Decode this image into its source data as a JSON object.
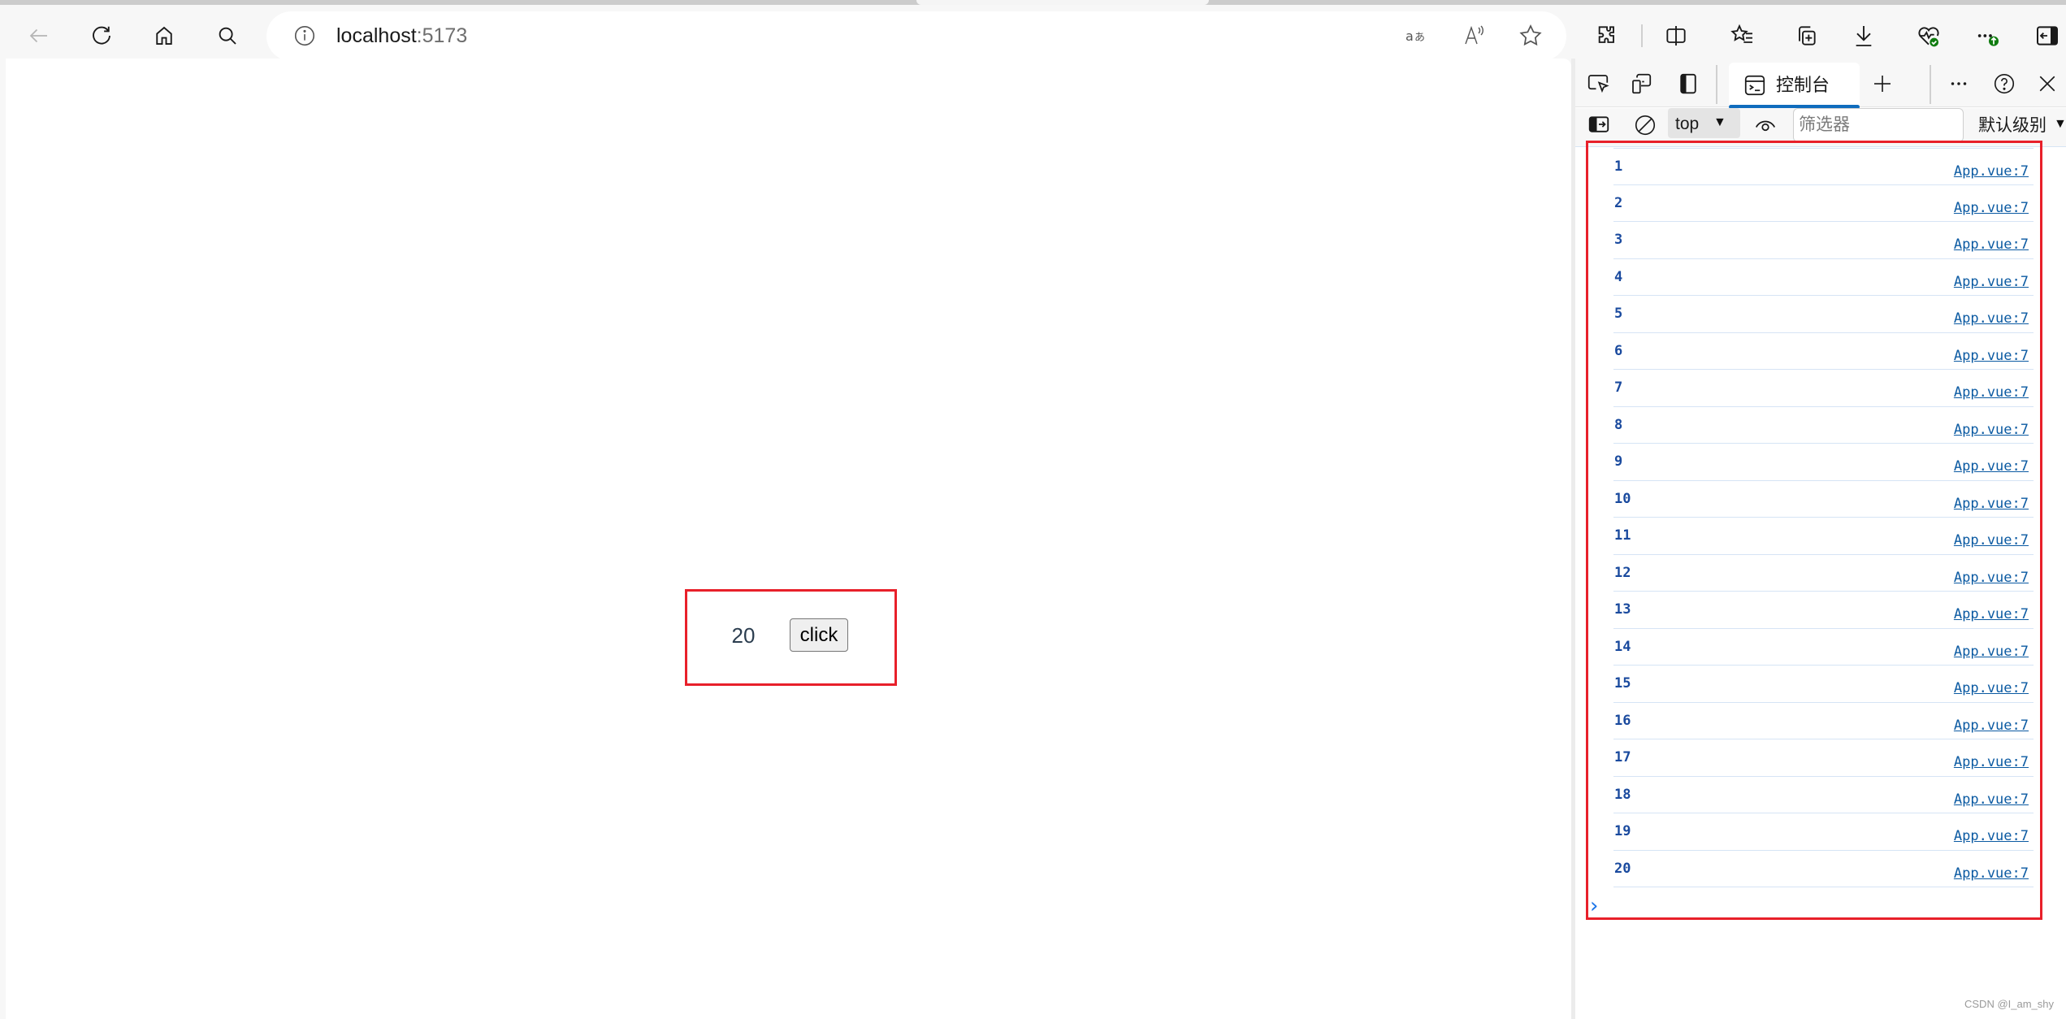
{
  "browser": {
    "url_host": "localhost",
    "url_port": ":5173",
    "nav": {
      "back": "back-arrow-icon",
      "refresh": "refresh-icon",
      "home": "home-icon",
      "search": "search-icon"
    },
    "address_icons": [
      "site-info-icon",
      "translate-icon",
      "read-aloud-icon",
      "favorite-star-icon"
    ],
    "toolbar_icons": [
      "extensions-icon",
      "split-screen-icon",
      "favorites-icon",
      "collections-icon",
      "downloads-icon",
      "browser-essentials-icon",
      "more-icon",
      "sidebar-toggle-icon"
    ]
  },
  "page": {
    "count": "20",
    "button_label": "click",
    "accent_color": "#e8202a"
  },
  "devtools": {
    "tab_label": "控制台",
    "context": "top",
    "filter_placeholder": "筛选器",
    "level_label": "默认级别",
    "prompt": "›",
    "console_rows": [
      {
        "value": "1",
        "source": "App.vue:7"
      },
      {
        "value": "2",
        "source": "App.vue:7"
      },
      {
        "value": "3",
        "source": "App.vue:7"
      },
      {
        "value": "4",
        "source": "App.vue:7"
      },
      {
        "value": "5",
        "source": "App.vue:7"
      },
      {
        "value": "6",
        "source": "App.vue:7"
      },
      {
        "value": "7",
        "source": "App.vue:7"
      },
      {
        "value": "8",
        "source": "App.vue:7"
      },
      {
        "value": "9",
        "source": "App.vue:7"
      },
      {
        "value": "10",
        "source": "App.vue:7"
      },
      {
        "value": "11",
        "source": "App.vue:7"
      },
      {
        "value": "12",
        "source": "App.vue:7"
      },
      {
        "value": "13",
        "source": "App.vue:7"
      },
      {
        "value": "14",
        "source": "App.vue:7"
      },
      {
        "value": "15",
        "source": "App.vue:7"
      },
      {
        "value": "16",
        "source": "App.vue:7"
      },
      {
        "value": "17",
        "source": "App.vue:7"
      },
      {
        "value": "18",
        "source": "App.vue:7"
      },
      {
        "value": "19",
        "source": "App.vue:7"
      },
      {
        "value": "20",
        "source": "App.vue:7"
      }
    ]
  },
  "watermark": "CSDN @I_am_shy"
}
